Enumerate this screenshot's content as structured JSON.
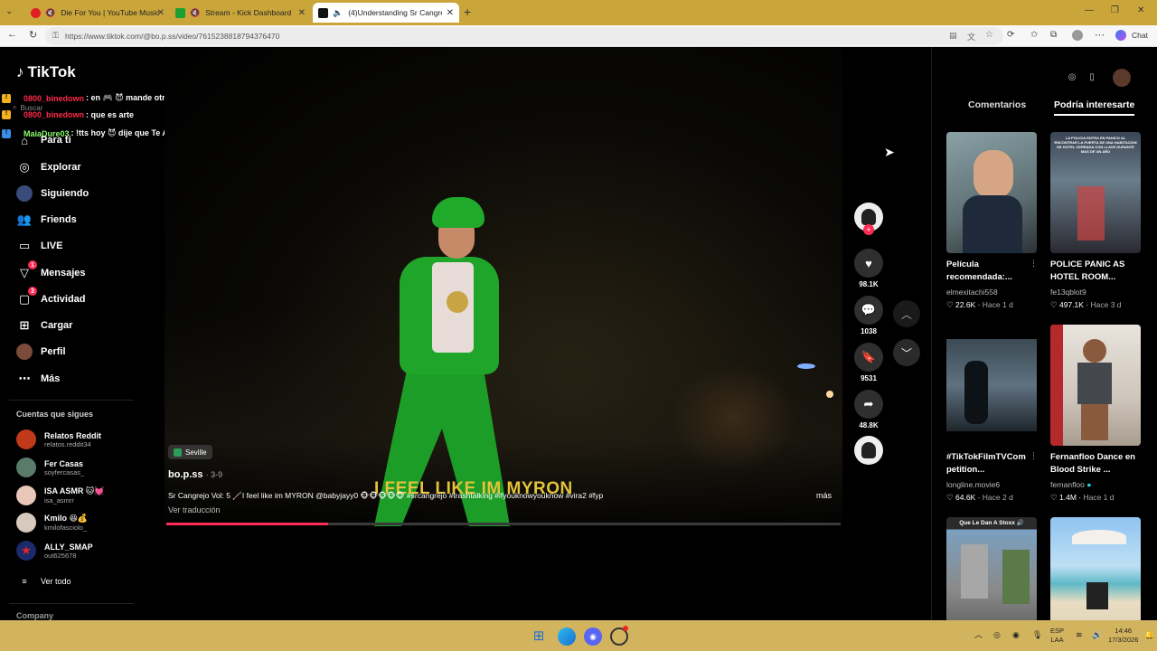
{
  "browser": {
    "tabs": [
      {
        "title": "Die For You | YouTube Music",
        "active": false
      },
      {
        "title": "Stream - Kick Dashboard",
        "active": false
      },
      {
        "title": "(4)Understanding Sr Cangrejo",
        "active": true
      }
    ],
    "url": "https://www.tiktok.com/@bo.p.ss/video/7615238818794376470",
    "chat_label": "Chat"
  },
  "tiktok": {
    "logo": "TikTok",
    "search_placeholder": "Buscar",
    "nav": [
      {
        "label": "Para ti",
        "icon": "home-icon"
      },
      {
        "label": "Explorar",
        "icon": "compass-icon"
      },
      {
        "label": "Siguiendo",
        "icon": "following-icon"
      },
      {
        "label": "Friends",
        "icon": "friends-icon"
      },
      {
        "label": "LIVE",
        "icon": "live-icon"
      },
      {
        "label": "Mensajes",
        "icon": "messages-icon",
        "badge": "1"
      },
      {
        "label": "Actividad",
        "icon": "activity-icon",
        "badge": "3"
      },
      {
        "label": "Cargar",
        "icon": "upload-icon"
      },
      {
        "label": "Perfil",
        "icon": "profile-icon"
      },
      {
        "label": "Más",
        "icon": "more-icon"
      }
    ],
    "following_title": "Cuentas que sigues",
    "following": [
      {
        "name": "Relatos Reddit",
        "handle": "relatos.reddit34"
      },
      {
        "name": "Fer Casas",
        "handle": "soyfercasas_"
      },
      {
        "name": "ISA ASMR 🐱💓",
        "handle": "isa_asmrr"
      },
      {
        "name": "Kmilo 😆💰",
        "handle": "kmilofasciolo_"
      },
      {
        "name": "ALLY_SMAP",
        "handle": "out625678"
      }
    ],
    "see_all": "Ver todo",
    "company": "Company"
  },
  "chat_overlay": [
    {
      "user": "0800_binedown",
      "message": ": en 🎮 😈 mande otro"
    },
    {
      "user": "0800_binedown",
      "message": ": que es arte"
    },
    {
      "user": "MaiaDure03",
      "message": ": !tts hoy 😈 dije que Te Amo, porque Te Amo muchisimo 💚"
    }
  ],
  "video": {
    "location": "Seville",
    "author": "bo.p.ss",
    "date": "3-9",
    "caption": "Sr Cangrejo Vol: 5 🦯I feel like im MYRON @babyjayy0 🐵🐵🐵🐵🐵 #srcangrejo #trashtalking #ifyouknowyouknow #vira2 #fyp",
    "more": "más",
    "translate": "Ver traducción",
    "subtitle": "I FEEL LIKE IM MYRON",
    "progress": 0.24
  },
  "actions": {
    "likes": "98.1K",
    "comments": "1038",
    "saves": "9531",
    "shares": "48.8K"
  },
  "right_panel": {
    "tabs": [
      "Comentarios",
      "Podría interesarte"
    ],
    "active_tab": "Podría interesarte",
    "cards": [
      {
        "title": "Película recomendada:...",
        "user": "elmexitachi558",
        "likes": "22.6K",
        "age": "Hace 1 d"
      },
      {
        "title": "POLICE PANIC AS HOTEL ROOM...",
        "user": "fe13qblot9",
        "likes": "497.1K",
        "age": "Hace 3 d"
      },
      {
        "title": "#TikTokFilmTVCom petition...",
        "user": "longline.movie6",
        "likes": "64.6K",
        "age": "Hace 2 d"
      },
      {
        "title": "Fernanfloo Dance en Blood Strike ...",
        "user": "fernanfloo",
        "likes": "1.4M",
        "age": "Hace 1 d"
      },
      {
        "title": "Que Le Dan A Stoxx",
        "user": "",
        "likes": "",
        "age": ""
      },
      {
        "title": "",
        "user": "",
        "likes": "",
        "age": ""
      }
    ],
    "thumb_text_1": "LA POLICIA ENTRA EN PANICO AL ENCONTRAR LA PUERTA DE UNA HABITACION DE HOTEL CERRADA CON LLAVE DURANTE MAS DE UN AÑO",
    "thumb_text_2": "Que Le Dan A Stoxx 🔊"
  },
  "taskbar": {
    "lang": "ESP",
    "lang2": "LAA",
    "time": "14:46",
    "date": "17/3/2026"
  }
}
